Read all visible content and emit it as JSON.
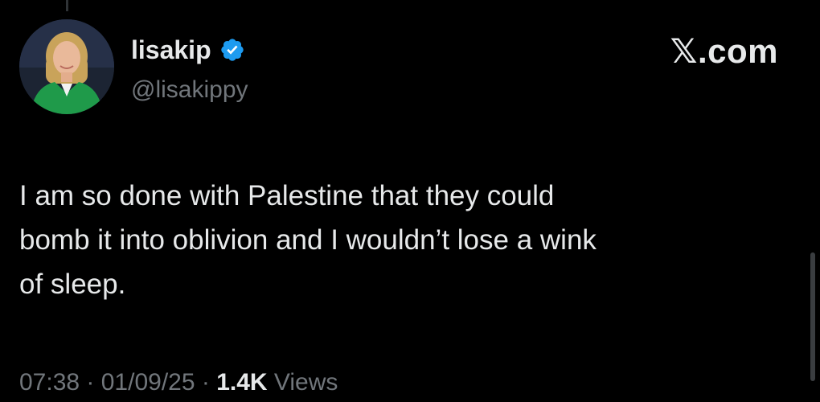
{
  "tweet": {
    "author": {
      "display_name": "lisakip",
      "handle": "@lisakippy",
      "verified": true
    },
    "source": "𝕏.com",
    "text": "I am so done with Palestine that they could\nbomb it into oblivion and I wouldn’t lose a wink\nof sleep.",
    "meta": {
      "time": "07:38",
      "separator": " · ",
      "date": "01/09/25",
      "views_count": "1.4K",
      "views_label": " Views"
    }
  },
  "colors": {
    "background": "#000000",
    "primary_text": "#e7e9ea",
    "secondary_text": "#71767b",
    "verified_blue": "#1d9bf0"
  },
  "icons": {
    "verified": "verified-badge-icon",
    "avatar": "profile-photo"
  }
}
